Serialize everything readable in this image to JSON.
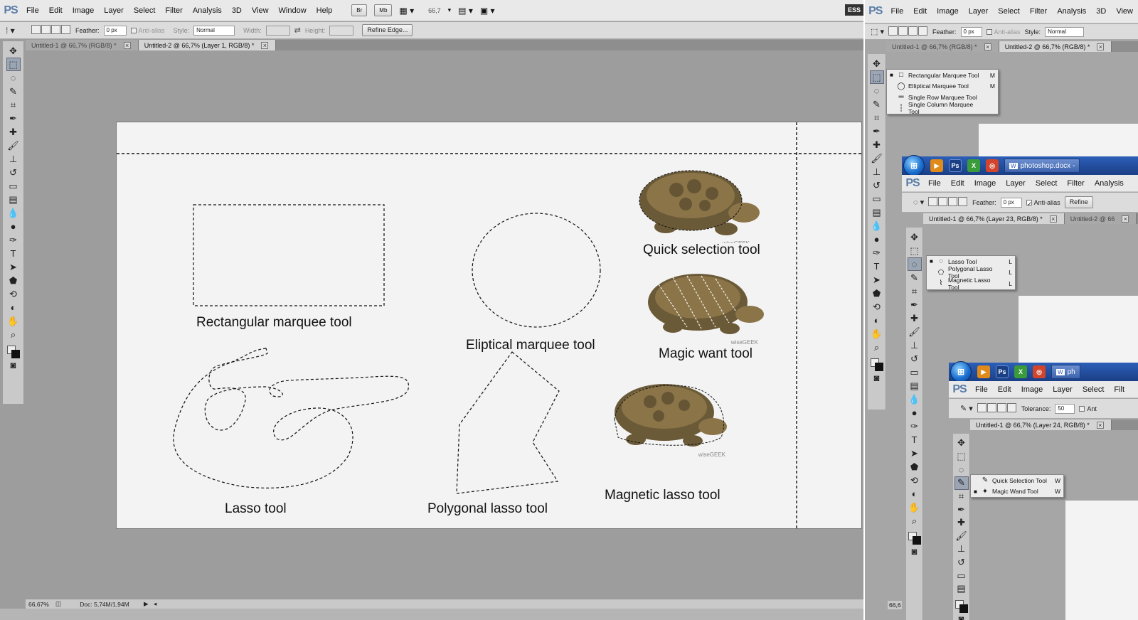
{
  "main_window": {
    "logo": "PS",
    "menu": [
      "File",
      "Edit",
      "Image",
      "Layer",
      "Select",
      "Filter",
      "Analysis",
      "3D",
      "View",
      "Window",
      "Help"
    ],
    "bridge_buttons": [
      "Br",
      "Mb"
    ],
    "zoom_field": "66,7",
    "essentials_label": "ESS",
    "options": {
      "feather_label": "Feather:",
      "feather_value": "0 px",
      "antialias_label": "Anti-alias",
      "style_label": "Style:",
      "style_value": "Normal",
      "width_label": "Width:",
      "height_label": "Height:",
      "refine_edge": "Refine Edge..."
    },
    "tabs": [
      {
        "label": "Untitled-1 @ 66,7% (RGB/8) *",
        "active": false
      },
      {
        "label": "Untitled-2 @ 66,7% (Layer 1, RGB/8) *",
        "active": true
      }
    ],
    "status": {
      "zoom": "66,67%",
      "doc": "Doc: 5,74M/1,94M"
    }
  },
  "canvas_captions": {
    "rect": "Rectangular marquee tool",
    "ellipse": "Eliptical marquee tool",
    "lasso": "Lasso tool",
    "polygonal": "Polygonal lasso tool",
    "quick": "Quick selection tool",
    "magic": "Magic want tool",
    "magnetic": "Magnetic lasso tool",
    "watermark": "wiseGEEK"
  },
  "window2": {
    "logo": "PS",
    "menu": [
      "File",
      "Edit",
      "Image",
      "Layer",
      "Select",
      "Filter",
      "Analysis",
      "3D",
      "View"
    ],
    "options": {
      "feather_label": "Feather:",
      "feather_value": "0 px",
      "antialias_label": "Anti-alias",
      "style_label": "Style:",
      "style_value": "Normal"
    },
    "tabs": [
      {
        "label": "Untitled-1 @ 66,7% (RGB/8) *",
        "active": false
      },
      {
        "label": "Untitled-2 @ 66,7% (RGB/8) *",
        "active": true
      }
    ],
    "flyout": [
      {
        "name": "Rectangular Marquee Tool",
        "key": "M",
        "icon": "□",
        "bullet": "■"
      },
      {
        "name": "Elliptical Marquee Tool",
        "key": "M",
        "icon": "◯",
        "bullet": ""
      },
      {
        "name": "Single Row Marquee Tool",
        "key": "",
        "icon": "═",
        "bullet": ""
      },
      {
        "name": "Single Column Marquee Tool",
        "key": "",
        "icon": "┆",
        "bullet": ""
      }
    ],
    "status_zoom": "66,6"
  },
  "window3": {
    "taskbar_doc": "photoshop.docx -",
    "logo": "PS",
    "menu": [
      "File",
      "Edit",
      "Image",
      "Layer",
      "Select",
      "Filter",
      "Analysis"
    ],
    "options": {
      "feather_label": "Feather:",
      "feather_value": "0 px",
      "antialias_label": "Anti-alias",
      "refine": "Refine"
    },
    "tabs": [
      {
        "label": "Untitled-1 @ 66,7% (Layer 23, RGB/8) *",
        "active": true
      },
      {
        "label": "Untitled-2 @ 66",
        "active": false
      }
    ],
    "flyout": [
      {
        "name": "Lasso Tool",
        "key": "L",
        "icon": "◌",
        "bullet": "■"
      },
      {
        "name": "Polygonal Lasso Tool",
        "key": "L",
        "icon": "⬠",
        "bullet": ""
      },
      {
        "name": "Magnetic Lasso Tool",
        "key": "L",
        "icon": "⌇",
        "bullet": ""
      }
    ]
  },
  "window4": {
    "taskbar_doc": "ph",
    "logo": "PS",
    "menu": [
      "File",
      "Edit",
      "Image",
      "Layer",
      "Select",
      "Filt"
    ],
    "options": {
      "tolerance_label": "Tolerance:",
      "tolerance_value": "50",
      "antialias_label": "Ant"
    },
    "tabs": [
      {
        "label": "Untitled-1 @ 66,7% (Layer 24, RGB/8) *",
        "active": true
      }
    ],
    "flyout": [
      {
        "name": "Quick Selection Tool",
        "key": "W",
        "icon": "✎",
        "bullet": ""
      },
      {
        "name": "Magic Wand Tool",
        "key": "W",
        "icon": "✦",
        "bullet": "■"
      }
    ]
  },
  "colors": {
    "ps_blue": "#5a7da8",
    "canvas": "#f3f3f3",
    "workspace": "#9d9d9d",
    "xp_bar": "#2c5fb8"
  }
}
